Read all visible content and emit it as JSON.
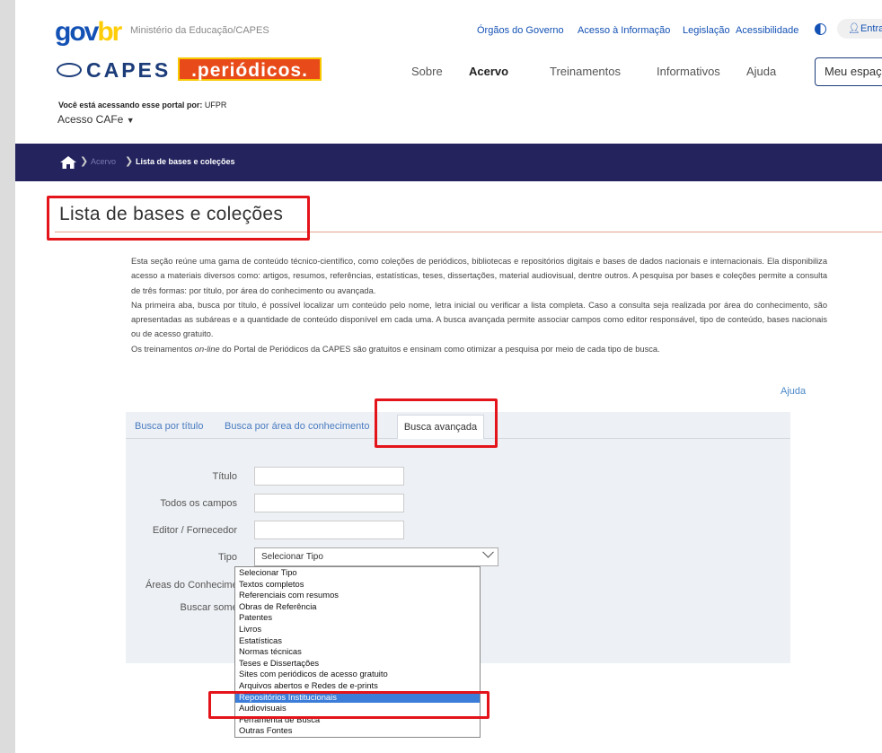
{
  "govbr": {
    "logo_gov": "gov",
    "logo_br": "br",
    "ministry": "Ministério da Educação/CAPES",
    "links": [
      "Órgãos do Governo",
      "Acesso à Informação",
      "Legislação",
      "Acessibilidade"
    ],
    "login_label": "Entrar"
  },
  "brand": {
    "capes": "CAPES",
    "periodicos": ".periódicos."
  },
  "nav": {
    "items": [
      "Sobre",
      "Acervo",
      "Treinamentos",
      "Informativos",
      "Ajuda"
    ],
    "active": "Acervo",
    "meu_espaco": "Meu espaço"
  },
  "access": {
    "prefix": "Você está acessando esse portal por:",
    "institution": "UFPR",
    "cafe": "Acesso CAFe"
  },
  "breadcrumb": {
    "items": [
      "Acervo",
      "Lista de bases e coleções"
    ]
  },
  "page": {
    "title": "Lista de bases e coleções",
    "description": [
      "Esta seção reúne uma gama de conteúdo técnico-científico, como coleções de periódicos, bibliotecas e repositórios digitais e bases de dados nacionais e internacionais. Ela disponibiliza acesso a materiais diversos como: artigos, resumos, referências, estatísticas, teses, dissertações, material audiovisual, dentre outros. A pesquisa por bases e coleções permite a consulta de três formas: por título, por área do conhecimento ou avançada.",
      "Na primeira aba, busca por título, é possível localizar um conteúdo pelo nome, letra inicial ou verificar a lista completa. Caso a consulta seja realizada por área do conhecimento, são apresentadas as subáreas e a quantidade de conteúdo disponível em cada uma. A busca avançada permite associar campos como editor responsável, tipo de conteúdo, bases nacionais ou de acesso gratuito."
    ],
    "training_before": "Os treinamentos ",
    "training_italic": "on-line",
    "training_after": " do Portal de Periódicos da CAPES são gratuitos e ensinam como otimizar a pesquisa por meio de cada tipo de busca.",
    "help_link": "Ajuda"
  },
  "search": {
    "tabs": [
      "Busca por título",
      "Busca por área do conhecimento",
      "Busca avançada"
    ],
    "active_tab": "Busca avançada",
    "fields": {
      "titulo": "Título",
      "todos": "Todos os campos",
      "editor": "Editor / Fornecedor",
      "tipo": "Tipo",
      "areas": "Áreas do Conhecimento",
      "buscar": "Buscar somente"
    },
    "tipo_selected": "Selecionar Tipo",
    "tipo_options": [
      "Selecionar Tipo",
      "Textos completos",
      "Referenciais com resumos",
      "Obras de Referência",
      "Patentes",
      "Livros",
      "Estatísticas",
      "Normas técnicas",
      "Teses e Dissertações",
      "Sites com periódicos de acesso gratuito",
      "Arquivos abertos e Redes de e-prints",
      "Repositórios Institucionais",
      "Audiovisuais",
      "Ferramenta de Busca",
      "Outras Fontes"
    ],
    "highlighted_option": "Repositórios Institucionais"
  },
  "colors": {
    "navy": "#24235e",
    "govbr_blue": "#1351b4",
    "highlight_red": "#e4141b",
    "option_selected": "#3b7dd8"
  }
}
